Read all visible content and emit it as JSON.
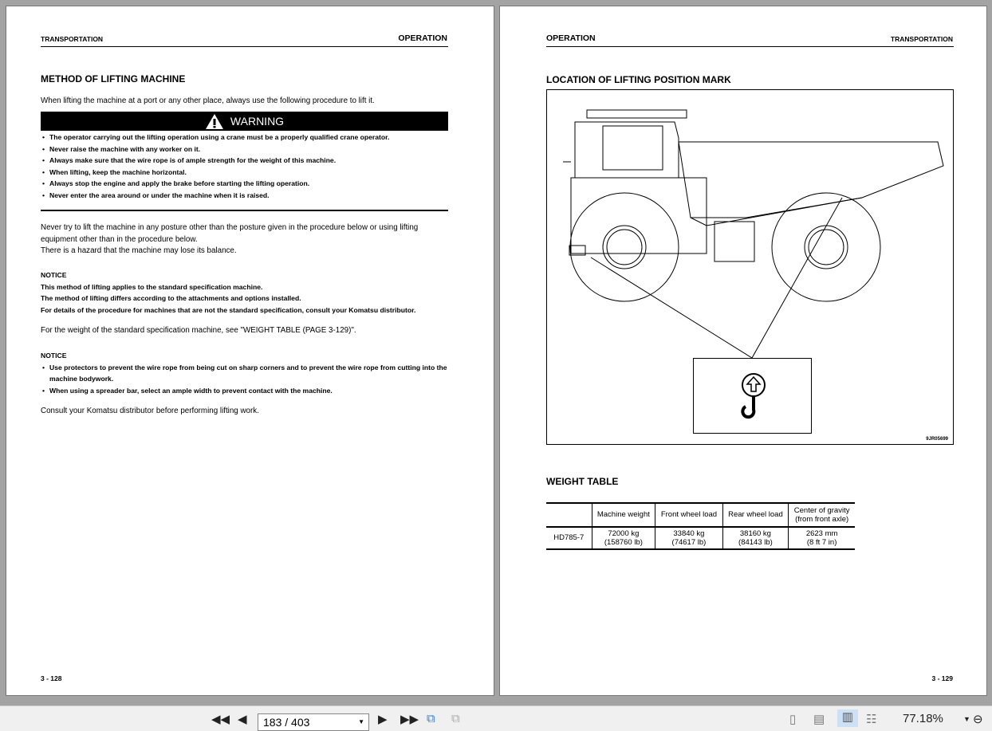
{
  "left_page": {
    "header_left": "TRANSPORTATION",
    "header_right": "OPERATION",
    "title": "METHOD OF LIFTING MACHINE",
    "intro": "When lifting the machine at a port or any other place, always use the following procedure to lift it.",
    "warning_label": "WARNING",
    "warning_items": [
      "The operator carrying out the lifting operation using a crane must be a properly qualified crane operator.",
      "Never raise the machine with any worker on it.",
      "Always make sure that the wire rope is of ample strength for the weight of this machine.",
      "When lifting, keep the machine horizontal.",
      "Always stop the engine and apply the brake before starting the lifting operation.",
      "Never enter the area around or under the machine when it is raised."
    ],
    "para1": [
      "Never try to lift the machine in any posture other than the posture given in the procedure below or using lifting",
      "equipment other than in the procedure below.",
      "There is a hazard that the machine may lose its balance."
    ],
    "notice1_title": "NOTICE",
    "notice1_lines": [
      "This method of lifting applies to the standard specification machine.",
      "The method of lifting differs according to the attachments and options installed.",
      "For details of the procedure for machines that are not the standard specification, consult your Komatsu distributor."
    ],
    "weight_ref": "For the weight of the standard specification machine, see \"WEIGHT TABLE (PAGE 3-129)\".",
    "notice2_title": "NOTICE",
    "notice2_items": [
      "Use protectors to prevent the wire rope from being cut on sharp corners and to prevent the wire rope from cutting into the machine bodywork.",
      "When using a spreader bar, select an ample width to prevent contact with the machine."
    ],
    "consult": "Consult your Komatsu distributor before performing lifting work.",
    "page_number": "3 - 128"
  },
  "right_page": {
    "header_left": "OPERATION",
    "header_right": "TRANSPORTATION",
    "title": "LOCATION OF LIFTING POSITION MARK",
    "figure_code": "9JR05699",
    "weight_title": "WEIGHT TABLE",
    "table": {
      "headers": [
        "",
        "Machine weight",
        "Front wheel load",
        "Rear wheel load",
        "Center of gravity\n(from front axle)"
      ],
      "header_lines": [
        [
          "Machine weight"
        ],
        [
          "Front wheel load"
        ],
        [
          "Rear wheel load"
        ],
        [
          "Center of gravity",
          "(from front axle)"
        ]
      ],
      "row": {
        "model": "HD785-7",
        "cells": [
          [
            "72000 kg",
            "(158760 lb)"
          ],
          [
            "33840 kg",
            "(74617 lb)"
          ],
          [
            "38160 kg",
            "(84143 lb)"
          ],
          [
            "2623 mm",
            "(8 ft 7 in)"
          ]
        ]
      }
    },
    "page_number": "3 - 129"
  },
  "toolbar": {
    "page_field": "183 / 403",
    "zoom": "77.18%"
  }
}
